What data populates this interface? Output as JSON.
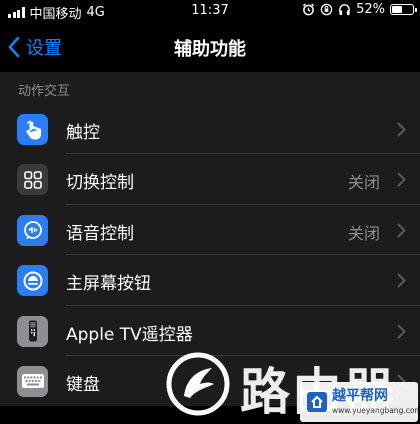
{
  "status_bar": {
    "carrier": "中国移动",
    "network": "4G",
    "time": "11:37",
    "battery": "52%",
    "battery_level": 0.52
  },
  "nav": {
    "back_label": "设置",
    "title": "辅助功能"
  },
  "section": {
    "header": "动作交互"
  },
  "rows": [
    {
      "label": "触控",
      "value": "",
      "icon": "touch-hand-icon",
      "color": "#2b7df2"
    },
    {
      "label": "切换控制",
      "value": "关闭",
      "icon": "switch-control-grid-icon",
      "color": "#3a3a3c"
    },
    {
      "label": "语音控制",
      "value": "关闭",
      "icon": "voice-control-icon",
      "color": "#2b7df2"
    },
    {
      "label": "主屏幕按钮",
      "value": "",
      "icon": "home-button-icon",
      "color": "#2b7df2"
    },
    {
      "label": "Apple TV遥控器",
      "value": "",
      "icon": "apple-tv-remote-icon",
      "color": "#8e8e93"
    },
    {
      "label": "键盘",
      "value": "",
      "icon": "keyboard-icon",
      "color": "#8e8e93"
    }
  ],
  "colors": {
    "accent": "#0a84ff",
    "background": "#000000",
    "cell": "#1c1c1e",
    "secondary_text": "#8e8e93"
  },
  "watermark": {
    "brand": "路由器",
    "site_name": "越平帮网",
    "site_url": "www.yueyangbang.com"
  }
}
